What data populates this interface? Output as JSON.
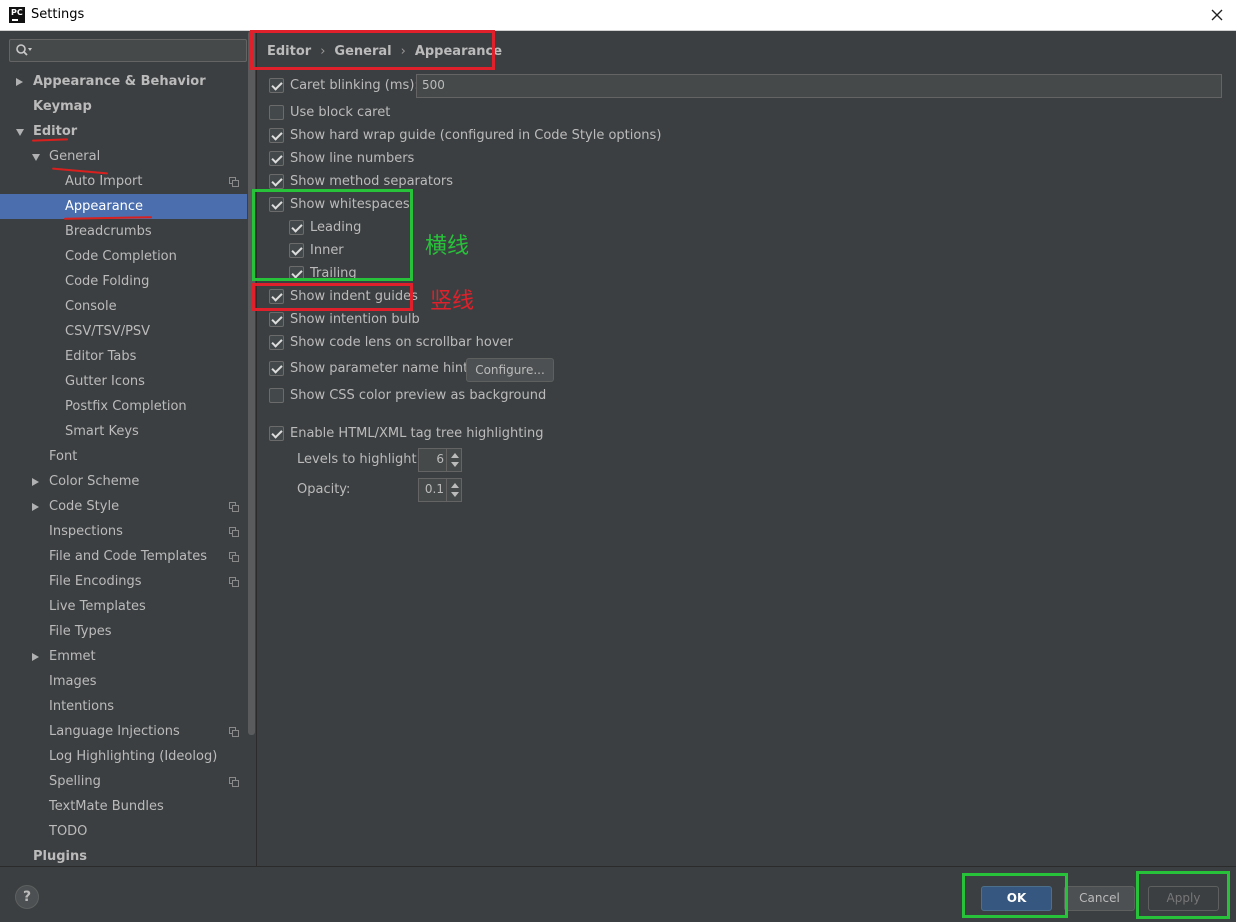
{
  "window": {
    "title": "Settings",
    "app_icon_text": "PC"
  },
  "sidebar": {
    "search": {
      "value": "",
      "placeholder": ""
    },
    "items": [
      {
        "label": "Appearance & Behavior",
        "level": 0,
        "arrow": "right",
        "bold": true
      },
      {
        "label": "Keymap",
        "level": 0,
        "arrow": "none",
        "bold": true
      },
      {
        "label": "Editor",
        "level": 0,
        "arrow": "down",
        "bold": true
      },
      {
        "label": "General",
        "level": 1,
        "arrow": "down"
      },
      {
        "label": "Auto Import",
        "level": 2,
        "icon": "copy-icon"
      },
      {
        "label": "Appearance",
        "level": 2,
        "selected": true
      },
      {
        "label": "Breadcrumbs",
        "level": 2
      },
      {
        "label": "Code Completion",
        "level": 2
      },
      {
        "label": "Code Folding",
        "level": 2
      },
      {
        "label": "Console",
        "level": 2
      },
      {
        "label": "CSV/TSV/PSV",
        "level": 2
      },
      {
        "label": "Editor Tabs",
        "level": 2
      },
      {
        "label": "Gutter Icons",
        "level": 2
      },
      {
        "label": "Postfix Completion",
        "level": 2
      },
      {
        "label": "Smart Keys",
        "level": 2
      },
      {
        "label": "Font",
        "level": 1
      },
      {
        "label": "Color Scheme",
        "level": 1,
        "arrow": "right"
      },
      {
        "label": "Code Style",
        "level": 1,
        "arrow": "right",
        "icon": "copy-icon"
      },
      {
        "label": "Inspections",
        "level": 1,
        "icon": "copy-icon"
      },
      {
        "label": "File and Code Templates",
        "level": 1,
        "icon": "copy-icon"
      },
      {
        "label": "File Encodings",
        "level": 1,
        "icon": "copy-icon"
      },
      {
        "label": "Live Templates",
        "level": 1
      },
      {
        "label": "File Types",
        "level": 1
      },
      {
        "label": "Emmet",
        "level": 1,
        "arrow": "right"
      },
      {
        "label": "Images",
        "level": 1
      },
      {
        "label": "Intentions",
        "level": 1
      },
      {
        "label": "Language Injections",
        "level": 1,
        "icon": "copy-icon"
      },
      {
        "label": "Log Highlighting (Ideolog)",
        "level": 1
      },
      {
        "label": "Spelling",
        "level": 1,
        "icon": "copy-icon"
      },
      {
        "label": "TextMate Bundles",
        "level": 1
      },
      {
        "label": "TODO",
        "level": 1
      },
      {
        "label": "Plugins",
        "level": 0,
        "bold": true
      }
    ]
  },
  "breadcrumb": [
    "Editor",
    "General",
    "Appearance"
  ],
  "options": {
    "caret_blinking": {
      "label": "Caret blinking (ms):",
      "checked": true,
      "value": "500"
    },
    "use_block_caret": {
      "label": "Use block caret",
      "checked": false
    },
    "hard_wrap_guide": {
      "label": "Show hard wrap guide (configured in Code Style options)",
      "checked": true
    },
    "line_numbers": {
      "label": "Show line numbers",
      "checked": true
    },
    "method_separators": {
      "label": "Show method separators",
      "checked": true
    },
    "whitespaces": {
      "label": "Show whitespaces",
      "checked": true
    },
    "leading": {
      "label": "Leading",
      "checked": true
    },
    "inner": {
      "label": "Inner",
      "checked": true
    },
    "trailing": {
      "label": "Trailing",
      "checked": true
    },
    "indent_guides": {
      "label": "Show indent guides",
      "checked": true
    },
    "intention_bulb": {
      "label": "Show intention bulb",
      "checked": true
    },
    "code_lens": {
      "label": "Show code lens on scrollbar hover",
      "checked": true
    },
    "parameter_hints": {
      "label": "Show parameter name hints",
      "checked": true,
      "button": "Configure..."
    },
    "css_color_preview": {
      "label": "Show CSS color preview as background",
      "checked": false
    },
    "tag_tree": {
      "label": "Enable HTML/XML tag tree highlighting",
      "checked": true
    },
    "levels": {
      "label": "Levels to highlight:",
      "value": "6"
    },
    "opacity": {
      "label": "Opacity:",
      "value": "0.1"
    }
  },
  "annotations": {
    "horizontal_note": "横线",
    "vertical_note": "竖线",
    "red": "#e0202a",
    "green": "#27c23a"
  },
  "footer": {
    "help": "?",
    "ok": "OK",
    "cancel": "Cancel",
    "apply": "Apply"
  },
  "colors": {
    "selection": "#4b6eaf",
    "background": "#3c3f41",
    "ok_button": "#365880"
  }
}
